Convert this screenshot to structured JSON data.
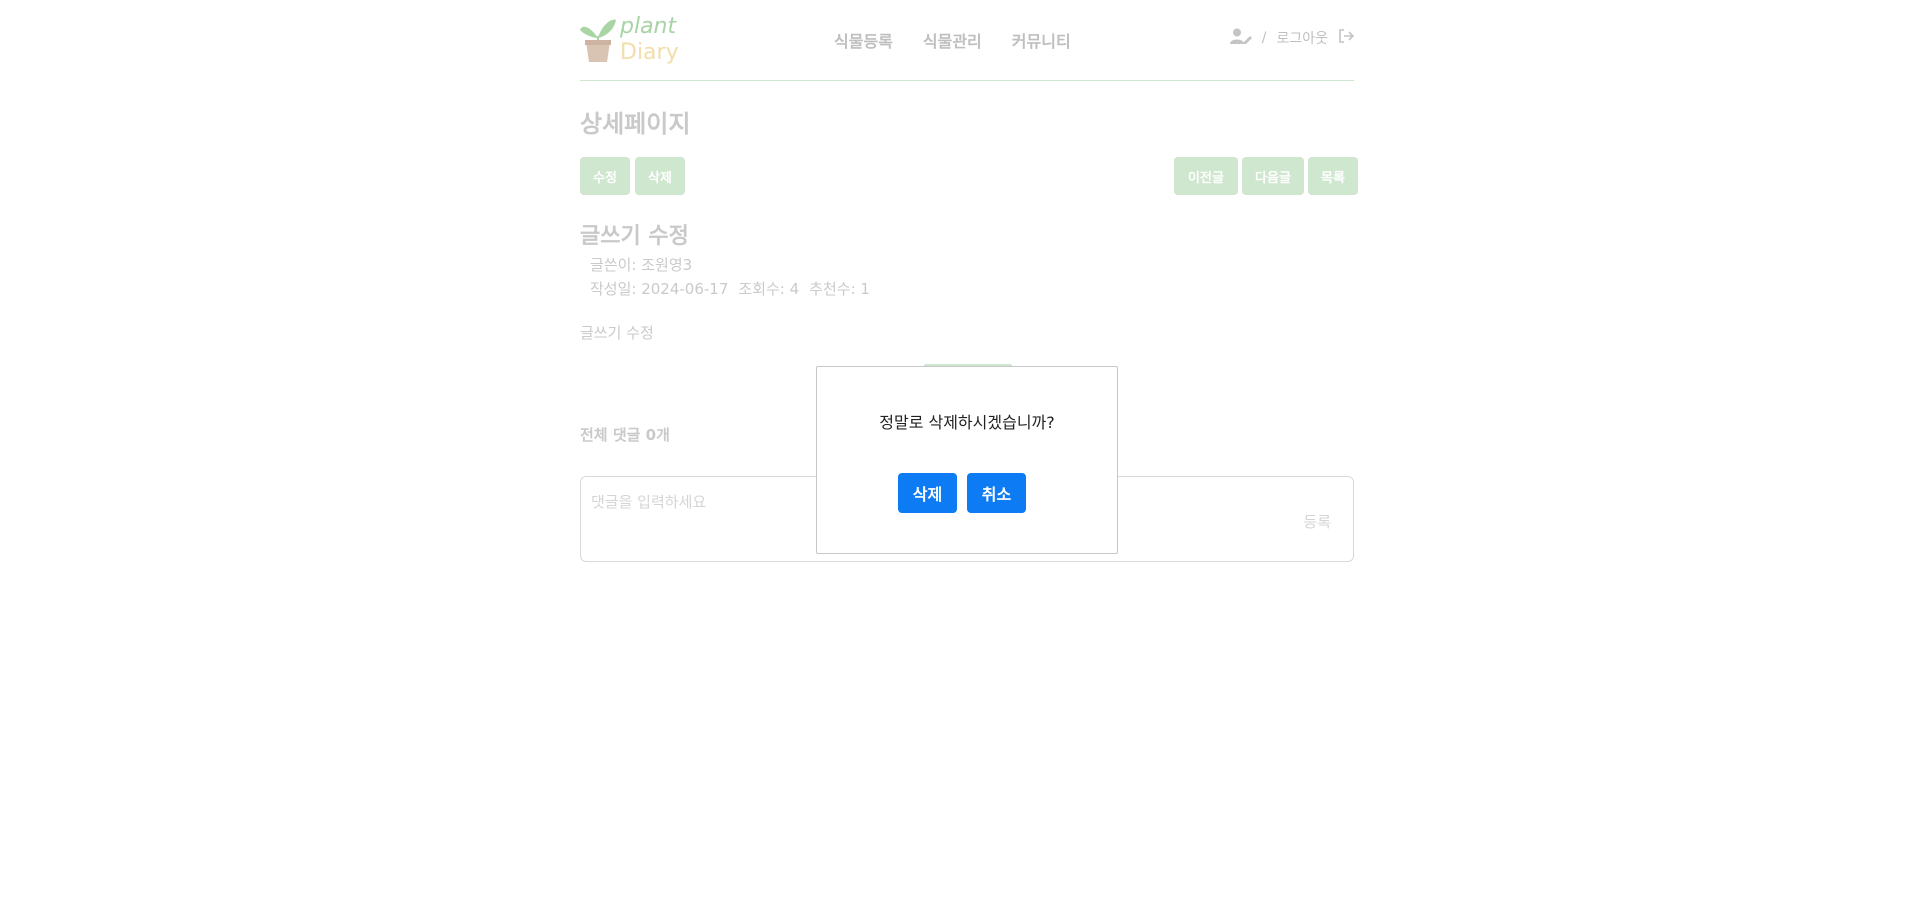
{
  "header": {
    "logo_line1": "plant",
    "logo_line2": "Diary",
    "nav": [
      "식물등록",
      "식물관리",
      "커뮤니티"
    ],
    "separator": "/",
    "logout_label": "로그아웃",
    "user_icon": "user-edit-icon",
    "logout_icon": "sign-out-icon"
  },
  "page_title": "상세페이지",
  "actions_left": [
    "수정",
    "삭제"
  ],
  "actions_right": [
    "이전글",
    "다음글",
    "목록"
  ],
  "post": {
    "title": "글쓰기 수정",
    "author_line": "글쓴이: 조원영3",
    "date": "작성일: 2024-06-17",
    "views": "조회수: 4",
    "recommends": "추천수: 1",
    "body": "글쓰기 수정"
  },
  "comments": {
    "count_label": "전체 댓글 0개",
    "placeholder": "댓글을 입력하세요",
    "submit_label": "등록"
  },
  "modal": {
    "message": "정말로 삭제하시겠습니까?",
    "confirm_label": "삭제",
    "cancel_label": "취소"
  },
  "colors": {
    "accent_green": "#cfe6cf",
    "modal_button": "#0d7bf3"
  }
}
